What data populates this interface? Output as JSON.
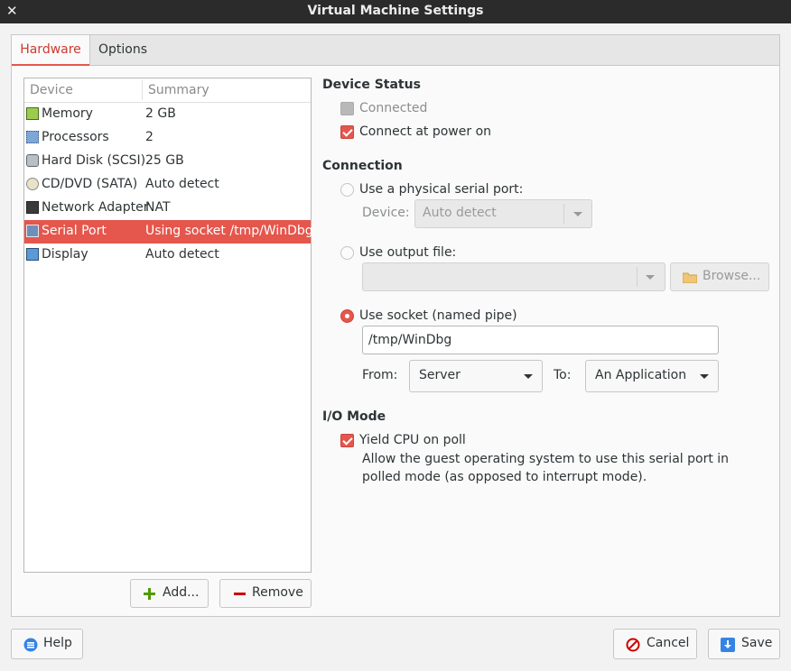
{
  "window": {
    "title": "Virtual Machine Settings",
    "close_glyph": "✕"
  },
  "tabs": [
    {
      "label": "Hardware",
      "active": true
    },
    {
      "label": "Options",
      "active": false
    }
  ],
  "device_list": {
    "columns": [
      "Device",
      "Summary"
    ],
    "devices": [
      {
        "icon": "memory-icon",
        "name": "Memory",
        "summary": "2 GB",
        "selected": false
      },
      {
        "icon": "processor-icon",
        "name": "Processors",
        "summary": "2",
        "selected": false
      },
      {
        "icon": "hard-disk-icon",
        "name": "Hard Disk (SCSI)",
        "summary": "25 GB",
        "selected": false
      },
      {
        "icon": "cd-dvd-icon",
        "name": "CD/DVD (SATA)",
        "summary": "Auto detect",
        "selected": false
      },
      {
        "icon": "network-adapter-icon",
        "name": "Network Adapter",
        "summary": "NAT",
        "selected": false
      },
      {
        "icon": "serial-port-icon",
        "name": "Serial Port",
        "summary": "Using socket /tmp/WinDbg",
        "selected": true
      },
      {
        "icon": "display-icon",
        "name": "Display",
        "summary": "Auto detect",
        "selected": false
      }
    ],
    "add_label": "Add...",
    "remove_label": "Remove"
  },
  "device_status": {
    "heading": "Device Status",
    "connected_label": "Connected",
    "connected_checked": false,
    "connected_disabled": true,
    "connect_at_power_on_label": "Connect at power on",
    "connect_at_power_on_checked": true
  },
  "connection": {
    "heading": "Connection",
    "physical_label": "Use a physical serial port:",
    "device_label": "Device:",
    "device_value": "Auto detect",
    "output_file_label": "Use output file:",
    "output_file_value": "",
    "browse_label": "Browse...",
    "socket_label": "Use socket (named pipe)",
    "socket_value": "/tmp/WinDbg",
    "selected_option": "socket",
    "from_label": "From:",
    "from_value": "Server",
    "to_label": "To:",
    "to_value": "An Application"
  },
  "io_mode": {
    "heading": "I/O Mode",
    "yield_label": "Yield CPU on poll",
    "yield_checked": true,
    "description": "Allow the guest operating system to use this serial port in polled mode (as opposed to interrupt mode)."
  },
  "footer": {
    "help_label": "Help",
    "cancel_label": "Cancel",
    "save_label": "Save"
  },
  "colors": {
    "accent": "#e5564c",
    "titlebar": "#2b2b2b",
    "background": "#f2f2f2"
  }
}
